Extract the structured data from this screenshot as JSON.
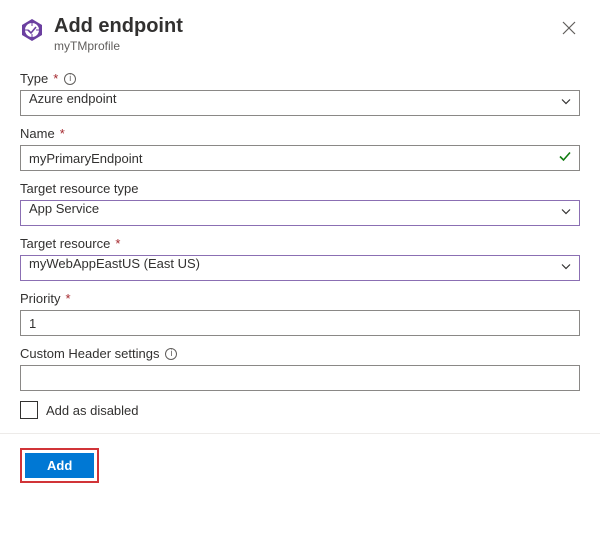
{
  "header": {
    "title": "Add endpoint",
    "subtitle": "myTMprofile"
  },
  "fields": {
    "type": {
      "label": "Type",
      "required": true,
      "info": true,
      "value": "Azure endpoint"
    },
    "name": {
      "label": "Name",
      "required": true,
      "info": false,
      "value": "myPrimaryEndpoint",
      "valid": true
    },
    "targetResourceType": {
      "label": "Target resource type",
      "required": false,
      "info": false,
      "value": "App Service"
    },
    "targetResource": {
      "label": "Target resource",
      "required": true,
      "info": false,
      "value": "myWebAppEastUS (East US)"
    },
    "priority": {
      "label": "Priority",
      "required": true,
      "info": false,
      "value": "1"
    },
    "customHeader": {
      "label": "Custom Header settings",
      "required": false,
      "info": true,
      "value": ""
    },
    "addAsDisabled": {
      "label": "Add as disabled",
      "checked": false
    }
  },
  "footer": {
    "add_label": "Add"
  }
}
